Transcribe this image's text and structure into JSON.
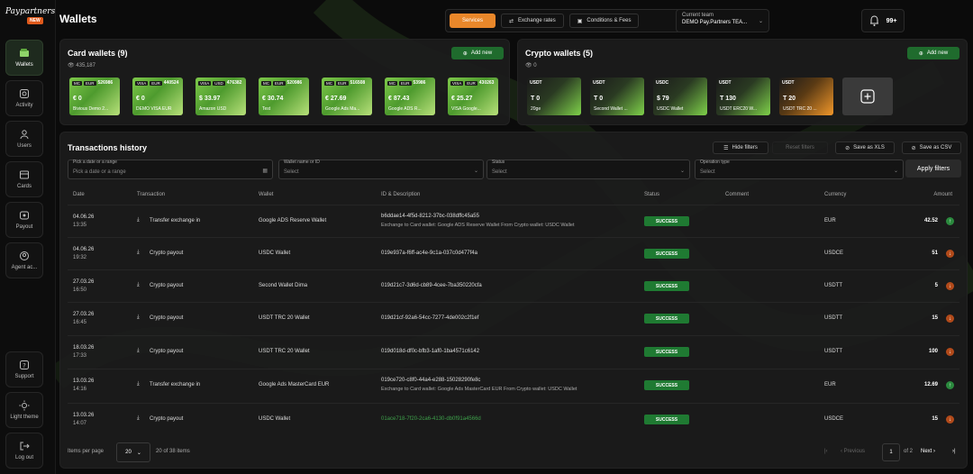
{
  "brand": {
    "logo_text": "Paypartners",
    "badge": "NEW"
  },
  "sidebar": {
    "items": [
      {
        "label": "Wallets",
        "icon": "wallet-icon",
        "active": true
      },
      {
        "label": "Activity",
        "icon": "activity-icon"
      },
      {
        "label": "Users",
        "icon": "users-icon"
      },
      {
        "label": "Cards",
        "icon": "cards-icon"
      },
      {
        "label": "Payout",
        "icon": "payout-icon"
      },
      {
        "label": "Agent ac...",
        "icon": "agent-icon"
      }
    ],
    "bottom": [
      {
        "label": "Support",
        "icon": "support-icon"
      },
      {
        "label": "Light theme",
        "icon": "sun-icon"
      },
      {
        "label": "Log out",
        "icon": "logout-icon"
      }
    ]
  },
  "header": {
    "title": "Wallets",
    "services": "Services",
    "exchange_rates": "Exchange rates",
    "conditions": "Conditions & Fees",
    "team_label": "Current team",
    "team_name": "DEMO Pay.Partners TEA...",
    "notifications": "99+"
  },
  "card_wallets": {
    "title": "Card wallets (9)",
    "subtitle": "435,187",
    "add_label": "Add new",
    "cards": [
      {
        "brand": "MC",
        "currency": "EUR",
        "number": "526986",
        "amount": "€ 0",
        "name": "Bivious Demo 2..."
      },
      {
        "brand": "VISA",
        "currency": "EUR",
        "number": "440524",
        "amount": "€ 0",
        "name": "DEMO VISA EUR"
      },
      {
        "brand": "VISA",
        "currency": "USD",
        "number": "476382",
        "amount": "$ 33.97",
        "name": "Amazon USD"
      },
      {
        "brand": "MC",
        "currency": "EUR",
        "number": "520986",
        "amount": "€ 30.74",
        "name": "Test"
      },
      {
        "brand": "MC",
        "currency": "EUR",
        "number": "516508",
        "amount": "€ 27.69",
        "name": "Google Ads Ma..."
      },
      {
        "brand": "MC",
        "currency": "EUR",
        "number": "53986",
        "amount": "€ 87.43",
        "name": "Google ADS R..."
      },
      {
        "brand": "VISA",
        "currency": "EUR",
        "number": "430263",
        "amount": "€ 25.27",
        "name": "VISA Google..."
      }
    ]
  },
  "crypto_wallets": {
    "title": "Crypto wallets (5)",
    "subtitle": "0",
    "add_label": "Add new",
    "wallets": [
      {
        "currency": "USDT",
        "amount": "T 0",
        "name": "20ge",
        "theme": "green"
      },
      {
        "currency": "USDT",
        "amount": "T 0",
        "name": "Second Wallet ...",
        "theme": "green"
      },
      {
        "currency": "USDC",
        "amount": "$ 79",
        "name": "USDC Wallet",
        "theme": "green"
      },
      {
        "currency": "USDT",
        "amount": "T 130",
        "name": "USDT ERC20 W...",
        "theme": "green"
      },
      {
        "currency": "USDT",
        "amount": "T 20",
        "name": "USDT TRC 20 ...",
        "theme": "orange"
      }
    ]
  },
  "transactions": {
    "title": "Transactions history",
    "hide_filters": "Hide filters",
    "reset_filters": "Reset filters",
    "save_xls": "Save as XLS",
    "save_csv": "Save as CSV",
    "filters": {
      "date": {
        "label": "Pick a date or a range",
        "placeholder": "Pick a date or a range"
      },
      "wallet": {
        "label": "Wallet name or ID",
        "placeholder": "Select"
      },
      "status": {
        "label": "Status",
        "placeholder": "Select"
      },
      "operation": {
        "label": "Operation type",
        "placeholder": "Select"
      }
    },
    "apply_filters": "Apply filters",
    "columns": [
      "Date",
      "Transaction",
      "Wallet",
      "ID & Description",
      "Status",
      "Comment",
      "Currency",
      "Amount"
    ],
    "rows": [
      {
        "date": "04.06.26",
        "time": "13:35",
        "type": "Transfer exchange in",
        "wallet": "Google ADS Reserve Wallet",
        "id": "b6ddae14-4f5d-8212-37bc-038dffc45a55",
        "desc": "Exchange to Card wallet: Google ADS Reserve Wallet From Crypto wallet: USDC Wallet",
        "status": "SUCCESS",
        "currency": "EUR",
        "amount": "42.52",
        "dir": "up"
      },
      {
        "date": "04.06.26",
        "time": "19:32",
        "type": "Crypto payout",
        "wallet": "USDC Wallet",
        "id": "019e937a-f6ff-ac4e-9c1a-037c0d477f4a",
        "desc": "",
        "status": "SUCCESS",
        "currency": "USDCE",
        "amount": "51",
        "dir": "down"
      },
      {
        "date": "27.03.26",
        "time": "16:50",
        "type": "Crypto payout",
        "wallet": "Second Wallet Dima",
        "id": "019d21c7-3d6d-cb89-4cee-7ba350220cfa",
        "desc": "",
        "status": "SUCCESS",
        "currency": "USDTT",
        "amount": "5",
        "dir": "down"
      },
      {
        "date": "27.03.26",
        "time": "16:45",
        "type": "Crypto payout",
        "wallet": "USDT TRC 20 Wallet",
        "id": "019d21cf-92a6-54cc-7277-4de002c2f1ef",
        "desc": "",
        "status": "SUCCESS",
        "currency": "USDTT",
        "amount": "15",
        "dir": "down"
      },
      {
        "date": "18.03.26",
        "time": "17:33",
        "type": "Crypto payout",
        "wallet": "USDT TRC 20 Wallet",
        "id": "019d018d-df0c-bfb3-1af0-1ba4571c6142",
        "desc": "",
        "status": "SUCCESS",
        "currency": "USDTT",
        "amount": "100",
        "dir": "down"
      },
      {
        "date": "13.03.26",
        "time": "14:16",
        "type": "Transfer exchange in",
        "wallet": "Google Ads MasterCard EUR",
        "id": "019ce720-c8f0-44a4-e288-15028290fe8c",
        "desc": "Exchange to Card wallet: Google Ads MasterCard EUR From Crypto wallet: USDC Wallet",
        "status": "SUCCESS",
        "currency": "EUR",
        "amount": "12.69",
        "dir": "up"
      },
      {
        "date": "13.03.26",
        "time": "14:07",
        "type": "Crypto payout",
        "wallet": "USDC Wallet",
        "id": "01ace718-7f20-2ca6-4130-db0f91a4566d",
        "desc": "",
        "status": "SUCCESS",
        "currency": "USDCE",
        "amount": "15",
        "dir": "down",
        "link": true
      }
    ],
    "pager": {
      "items_label": "Items per page",
      "per_page": "20",
      "range": "20 of 38 items",
      "previous": "Previous",
      "page": "1",
      "of": "of 2",
      "next": "Next"
    }
  },
  "colors": {
    "accent": "#e9872a",
    "success": "#1f7a32",
    "add": "#1f6b2d"
  }
}
